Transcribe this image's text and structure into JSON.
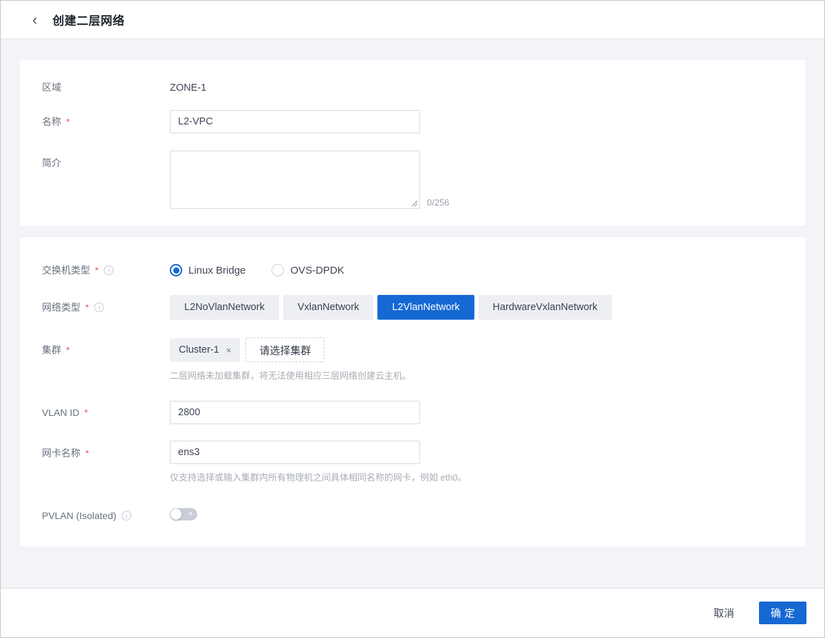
{
  "header": {
    "back_icon": "‹",
    "title": "创建二层网络"
  },
  "icons": {
    "info": "i",
    "close": "×",
    "toggle_off": "×"
  },
  "form": {
    "required_marker": "*",
    "zone": {
      "label": "区域",
      "value": "ZONE-1"
    },
    "name": {
      "label": "名称",
      "value": "L2-VPC"
    },
    "description": {
      "label": "简介",
      "value": "",
      "counter": "0/256"
    },
    "switch_type": {
      "label": "交换机类型",
      "options": [
        {
          "label": "Linux Bridge",
          "selected": true
        },
        {
          "label": "OVS-DPDK",
          "selected": false
        }
      ]
    },
    "network_type": {
      "label": "网络类型",
      "options": [
        "L2NoVlanNetwork",
        "VxlanNetwork",
        "L2VlanNetwork",
        "HardwareVxlanNetwork"
      ],
      "selected": "L2VlanNetwork"
    },
    "cluster": {
      "label": "集群",
      "tag": "Cluster-1",
      "select_button": "请选择集群",
      "helper": "二层网络未加载集群，将无法使用相应三层网络创建云主机。"
    },
    "vlan_id": {
      "label": "VLAN ID",
      "value": "2800"
    },
    "nic_name": {
      "label": "网卡名称",
      "value": "ens3",
      "helper": "仅支持选择或输入集群内所有物理机之间具体相同名称的网卡，例如 eth0。"
    },
    "pvlan": {
      "label": "PVLAN (Isolated)",
      "state": "off"
    }
  },
  "footer": {
    "cancel_label": "取消",
    "confirm_label": "确定"
  },
  "colors": {
    "primary": "#1668d3",
    "required": "#f25a5a",
    "page_background": "#f2f4f8"
  }
}
